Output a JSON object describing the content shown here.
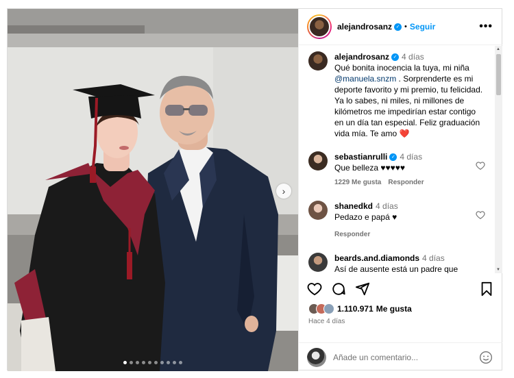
{
  "header": {
    "username": "alejandrosanz",
    "separator": "•",
    "follow_label": "Seguir",
    "more_icon": "more-horizontal-icon"
  },
  "caption": {
    "username": "alejandrosanz",
    "time": "4 días",
    "text_before": "Qué bonita inocencia la tuya, mi niña ",
    "mention": "@manuela.snzm",
    "text_after": " . Sorprenderte es mi deporte favorito y mi premio, tu felicidad. Ya lo sabes, ni miles, ni millones de kilómetros me impedirían estar contigo en un día tan especial. Feliz graduación vida mía. Te amo ",
    "emoji": "❤️"
  },
  "comments": [
    {
      "username": "sebastianrulli",
      "verified": true,
      "time": "4 días",
      "text": "Que belleza ♥♥♥♥♥",
      "likes": "1229 Me gusta",
      "reply": "Responder"
    },
    {
      "username": "shanedkd",
      "verified": false,
      "time": "4 días",
      "text": "Pedazo e papá ♥",
      "likes": "",
      "reply": "Responder"
    },
    {
      "username": "beards.and.diamonds",
      "verified": false,
      "time": "4 días",
      "text": "Así de ausente está un padre que",
      "likes": "",
      "reply": ""
    }
  ],
  "footer": {
    "likes_count": "1.110.971",
    "likes_label": "Me gusta",
    "time_ago": "Hace 4 días",
    "comment_placeholder": "Añade un comentario..."
  },
  "carousel": {
    "total": 10,
    "active": 0
  },
  "colors": {
    "accent": "#0095f6",
    "heart_red": "#ed4956",
    "robe_red": "#8e2236"
  }
}
